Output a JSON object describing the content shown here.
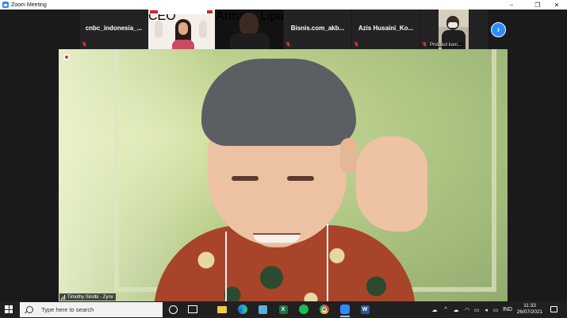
{
  "window": {
    "title": "Zoom Meeting",
    "minimize": "−",
    "maximize": "❐",
    "close": "✕"
  },
  "thumbnails": [
    {
      "label": "cnbc_indonesia_...",
      "type": "name"
    },
    {
      "label": "",
      "type": "video-slide",
      "small_label": "CEO"
    },
    {
      "label": "",
      "type": "video-dark",
      "small_label": "Arman_Liputanin..."
    },
    {
      "label": "Bisnis.com_akb...",
      "type": "name"
    },
    {
      "label": "Azis Husaini_Ko...",
      "type": "name"
    },
    {
      "label": "",
      "type": "video-masked",
      "small_label": "Protokol kom..."
    }
  ],
  "next_button": "›",
  "speaker": {
    "name": "Timothy Sindbi - Zynx"
  },
  "taskbar": {
    "search_placeholder": "Type here to search",
    "language": "IND",
    "time": "11:33",
    "date": "26/07/2021",
    "apps": [
      "cortana-icon",
      "task-view-icon",
      "file-explorer-icon",
      "edge-icon",
      "app-icon",
      "excel-icon",
      "spotify-icon",
      "chrome-icon",
      "zoom-icon",
      "word-icon"
    ],
    "excel_letter": "X",
    "word_letter": "W"
  }
}
